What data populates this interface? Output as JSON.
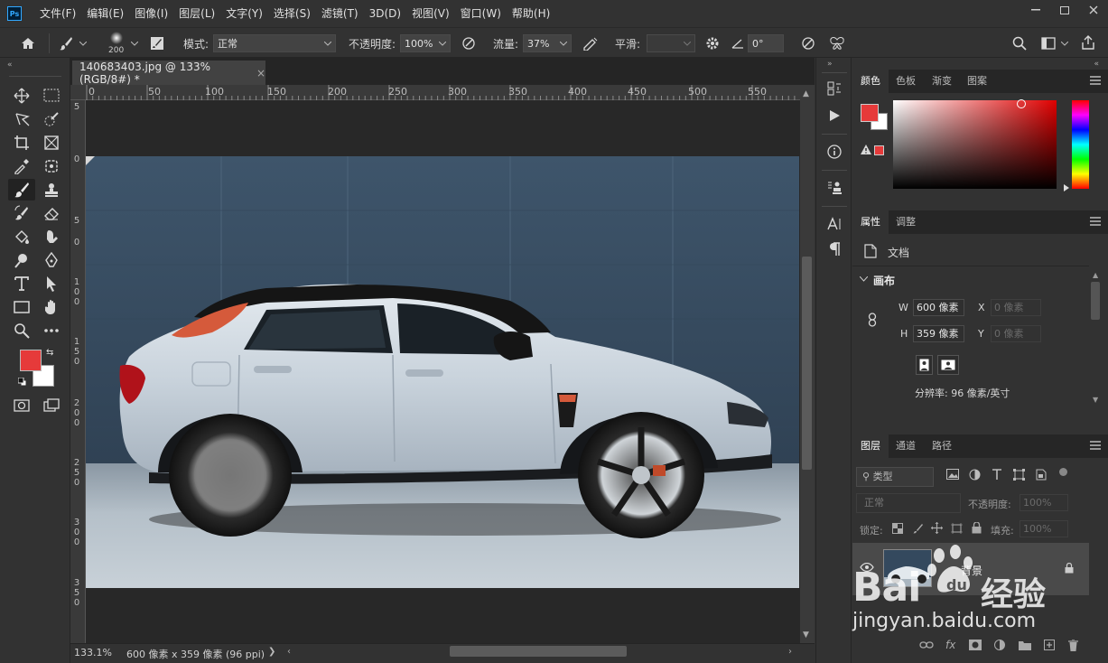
{
  "app": {
    "logo": "Ps"
  },
  "menu": [
    "文件(F)",
    "编辑(E)",
    "图像(I)",
    "图层(L)",
    "文字(Y)",
    "选择(S)",
    "滤镜(T)",
    "3D(D)",
    "视图(V)",
    "窗口(W)",
    "帮助(H)"
  ],
  "options": {
    "brush_size": "200",
    "mode_label": "模式:",
    "mode_value": "正常",
    "opacity_label": "不透明度:",
    "opacity_value": "100%",
    "flow_label": "流量:",
    "flow_value": "37%",
    "smooth_label": "平滑:",
    "smooth_value": "",
    "angle_value": "0°"
  },
  "document": {
    "tab_title": "140683403.jpg @ 133%(RGB/8#) *",
    "close_icon": "×"
  },
  "ruler": {
    "h_ticks": [
      "0",
      "50",
      "100",
      "150",
      "200",
      "250",
      "300",
      "350",
      "400",
      "450",
      "500",
      "550"
    ],
    "v_ticks": [
      "5",
      "0",
      "5",
      "0",
      "1 0 0",
      "1 5 0",
      "2 0 0",
      "2 5 0",
      "3 0 0",
      "3 5 0"
    ]
  },
  "status": {
    "zoom": "133.1%",
    "dimensions": "600 像素 x 359 像素 (96 ppi)",
    "arrow": "❯"
  },
  "color_panel": {
    "tabs": [
      "颜色",
      "色板",
      "渐变",
      "图案"
    ],
    "foreground": "#e63a3a",
    "background": "#ffffff",
    "hue_color": "#e00000"
  },
  "properties_panel": {
    "tabs": [
      "属性",
      "调整"
    ],
    "doc_label": "文档",
    "section": "画布",
    "w_label": "W",
    "w_value": "600 像素",
    "h_label": "H",
    "h_value": "359 像素",
    "x_label": "X",
    "x_value": "0 像素",
    "y_label": "Y",
    "y_value": "0 像素",
    "resolution": "分辨率: 96 像素/英寸"
  },
  "layers_panel": {
    "tabs": [
      "图层",
      "通道",
      "路径"
    ],
    "filter_label": "类型",
    "blend_mode": "正常",
    "opacity_label": "不透明度:",
    "opacity_value": "100%",
    "lock_label": "锁定:",
    "fill_label": "填充:",
    "fill_value": "100%",
    "layer_name": "背景"
  },
  "watermark": {
    "brand": "Bai",
    "brand2": "经验",
    "url": "jingyan.baidu.com"
  }
}
